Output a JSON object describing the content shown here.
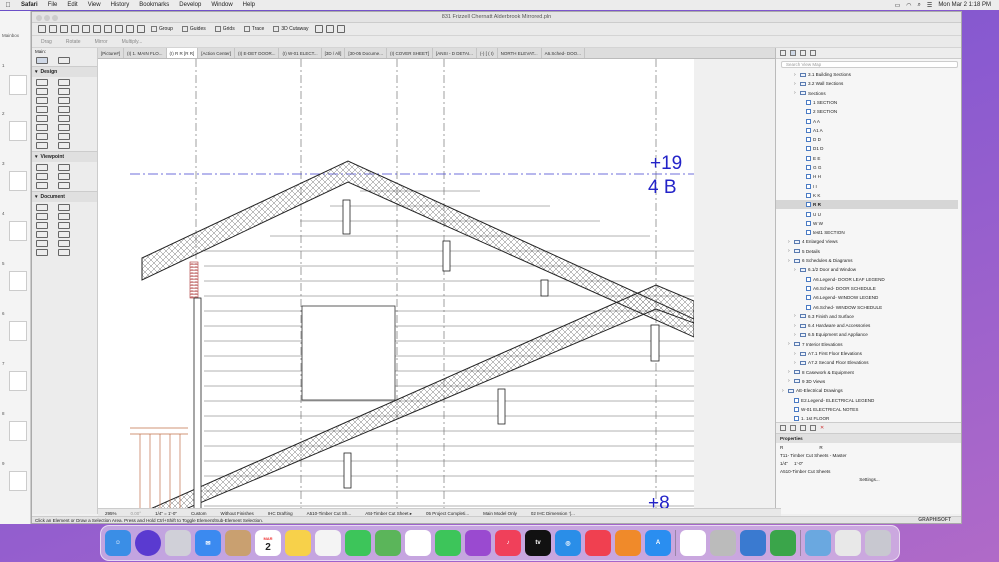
{
  "menubar": {
    "app": "Safari",
    "items": [
      "File",
      "Edit",
      "View",
      "History",
      "Bookmarks",
      "Develop",
      "Window",
      "Help"
    ],
    "clock": "Mon Mar 2  1:18 PM"
  },
  "window": {
    "title": "831 Frizzell Chernatt Alderbrook Mirrored.pln",
    "toolbar": {
      "group": "Group",
      "guides": "Guides",
      "grids": "Grids",
      "trace": "Trace",
      "cutaway": "3D Cutaway"
    },
    "toolbar2": {
      "drag": "Drag",
      "rotate": "Rotate",
      "mirror": "Mirror",
      "multiply": "Multiply..."
    },
    "sidebar_label": "Mainbox",
    "sidebar_pages": [
      "1",
      "2",
      "3",
      "4",
      "5",
      "6",
      "7",
      "8",
      "9"
    ],
    "main_label": "Main:"
  },
  "toolbox": {
    "design": "Design",
    "viewpoint": "Viewpoint",
    "document": "Document"
  },
  "tabs": [
    "[Picture#]",
    "(I) 1. MAIN FLO...",
    "(I) R R [R R]",
    "[Action Center]",
    "(I) E-DET DOOR...",
    "(I) W-01 ELECT...",
    "[3D / All]",
    "[30-05 Docume...",
    "(I) COVER SHEET]",
    "[ANSI - D DETAI...",
    "(-) [ ( I)",
    "NORTH ELEVAT...",
    "A6.Sched- DOO..."
  ],
  "canvas": {
    "label1": "+19",
    "label2": "4 B",
    "label3": "+8"
  },
  "navigator": {
    "search_placeholder": "Search View Map",
    "items": [
      {
        "label": "3.1 Building Sections",
        "level": 2,
        "kind": "folder"
      },
      {
        "label": "3.2 Wall Sections",
        "level": 2,
        "kind": "folder"
      },
      {
        "label": "Sections",
        "level": 2,
        "kind": "folder"
      },
      {
        "label": "1 SECTION",
        "level": 3,
        "kind": "view"
      },
      {
        "label": "2 SECTION",
        "level": 3,
        "kind": "view"
      },
      {
        "label": "A A",
        "level": 3,
        "kind": "view"
      },
      {
        "label": "A1 A",
        "level": 3,
        "kind": "view"
      },
      {
        "label": "D D",
        "level": 3,
        "kind": "view"
      },
      {
        "label": "D1 D",
        "level": 3,
        "kind": "view"
      },
      {
        "label": "E E",
        "level": 3,
        "kind": "view"
      },
      {
        "label": "G G",
        "level": 3,
        "kind": "view"
      },
      {
        "label": "H H",
        "level": 3,
        "kind": "view"
      },
      {
        "label": "I I",
        "level": 3,
        "kind": "view"
      },
      {
        "label": "K K",
        "level": 3,
        "kind": "view"
      },
      {
        "label": "R R",
        "level": 3,
        "kind": "view",
        "selected": true
      },
      {
        "label": "U U",
        "level": 3,
        "kind": "view"
      },
      {
        "label": "W W",
        "level": 3,
        "kind": "view"
      },
      {
        "label": "test1 SECTION",
        "level": 3,
        "kind": "view"
      },
      {
        "label": "4 Enlarged Views",
        "level": 1,
        "kind": "folder"
      },
      {
        "label": "5 Details",
        "level": 1,
        "kind": "folder"
      },
      {
        "label": "6 Schedules & Diagrams",
        "level": 1,
        "kind": "folder"
      },
      {
        "label": "6.1/2 Door and Window",
        "level": 2,
        "kind": "folder"
      },
      {
        "label": "A6.Legend- DOOR LEAF LEGEND",
        "level": 3,
        "kind": "sched"
      },
      {
        "label": "A6.Sched- DOOR SCHEDULE",
        "level": 3,
        "kind": "sched"
      },
      {
        "label": "A6.Legend- WINDOW LEGEND",
        "level": 3,
        "kind": "sched"
      },
      {
        "label": "A6.Sched- WINDOW SCHEDULE",
        "level": 3,
        "kind": "sched"
      },
      {
        "label": "6.3 Finish and Surface",
        "level": 2,
        "kind": "folder"
      },
      {
        "label": "6.4 Hardware and Accessories",
        "level": 2,
        "kind": "folder"
      },
      {
        "label": "6.5 Equipment and Appliance",
        "level": 2,
        "kind": "folder"
      },
      {
        "label": "7 Interior Elevations",
        "level": 1,
        "kind": "folder"
      },
      {
        "label": "A7.1 First Floor Elevations",
        "level": 2,
        "kind": "folder"
      },
      {
        "label": "A7.2 Second Floor Elevations",
        "level": 2,
        "kind": "folder"
      },
      {
        "label": "8 Casework & Equipment",
        "level": 1,
        "kind": "folder"
      },
      {
        "label": "9 3D Views",
        "level": 1,
        "kind": "folder"
      },
      {
        "label": "AE-Electrical Drawings",
        "level": 0,
        "kind": "folder"
      },
      {
        "label": "E2.Legend- ELECTRICAL LEGEND",
        "level": 1,
        "kind": "sched"
      },
      {
        "label": "W-01 ELECTRICAL NOTES",
        "level": 1,
        "kind": "sched"
      },
      {
        "label": "1. 1st FLOOR",
        "level": 1,
        "kind": "view"
      }
    ],
    "properties_title": "Properties",
    "prop_id": "R",
    "prop_id2": "R",
    "prop_layer": "T11- Timber Cut Sheets - Master",
    "prop_scale": "1/4\"",
    "prop_value": "1'-0\"",
    "prop_sheet": "A510-Timber Cut Sheets",
    "settings": "Settings..."
  },
  "statusbar": {
    "zoom": "295%",
    "angle": "0.00°",
    "scale": "1/4\"   =   1'-0\"",
    "layer": "Custom",
    "finishes": "Without Finishes",
    "drafting": "IHC Drafting",
    "sheet1": "A510-Timber Cut Sh...",
    "sheet2": "A5t-Timber Cut Sheet ▸",
    "complete": "05 Project Completi...",
    "model": "Main Model Only",
    "dimension": "02 IHC Dimension ’(..."
  },
  "hint": "Click an Element or Draw a Selection Area. Press and Hold Ctrl+Shift to Toggle Element/Sub-Element Selection.",
  "brand": "GRAPHISOFT",
  "dock": {
    "calendar_month": "MAR",
    "calendar_day": "2",
    "tv_label": "tv",
    "apps": [
      "Finder",
      "Siri",
      "Launchpad",
      "Mail",
      "Notes Book",
      "Calendar",
      "Notes",
      "Reminders",
      "FaceTime",
      "Maps",
      "Photos",
      "Messages",
      "Podcasts",
      "Music",
      "TV",
      "Safari",
      "News",
      "Books",
      "App Store",
      "Settings",
      "Preview",
      "Archicad",
      "Mainbox",
      "Numbers",
      "Folder",
      "Preview2",
      "Trash"
    ]
  }
}
